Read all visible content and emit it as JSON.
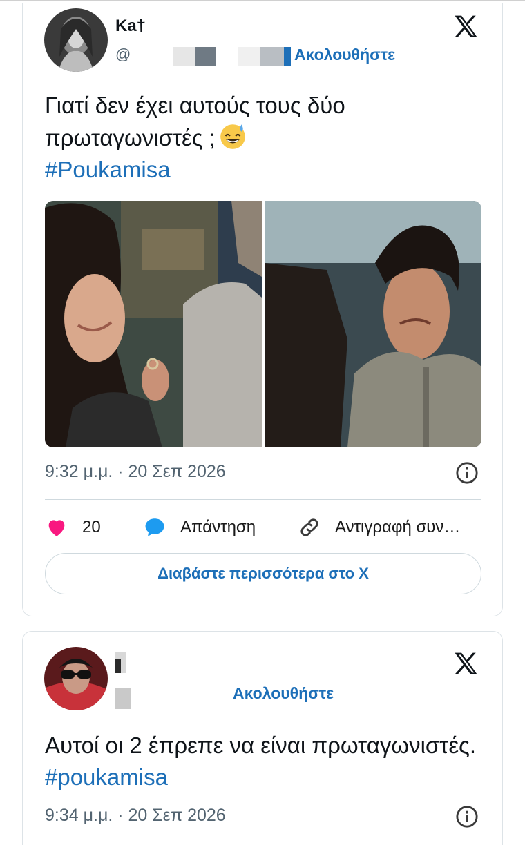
{
  "tweets": [
    {
      "name": "Ka†",
      "handle": "@",
      "follow_label": "Ακολουθήστε",
      "text_main": "Γιατί δεν έχει αυτούς τους δύο πρωταγωνιστές ;",
      "hashtag": "#Poukamisa",
      "timestamp": "9:32 μ.μ. · 20 Σεπ 2026",
      "likes": "20",
      "reply_label": "Απάντηση",
      "copy_label": "Αντιγραφή συν…",
      "read_more_label": "Διαβάστε περισσότερα στο X"
    },
    {
      "name": "",
      "handle": "",
      "follow_label": "Ακολουθήστε",
      "text_main": "Αυτοί οι 2 έπρεπε να είναι πρωταγωνιστές.",
      "hashtag": "#poukamisa",
      "timestamp": "9:34 μ.μ. · 20 Σεπ 2026"
    }
  ],
  "icons": {
    "brand": "x-logo-icon",
    "like": "heart-icon",
    "reply": "speech-bubble-icon",
    "copy": "link-icon",
    "info": "info-icon"
  },
  "colors": {
    "accent": "#1d6fb8",
    "like": "#f91880",
    "reply": "#1d9bf0",
    "muted": "#536471"
  }
}
